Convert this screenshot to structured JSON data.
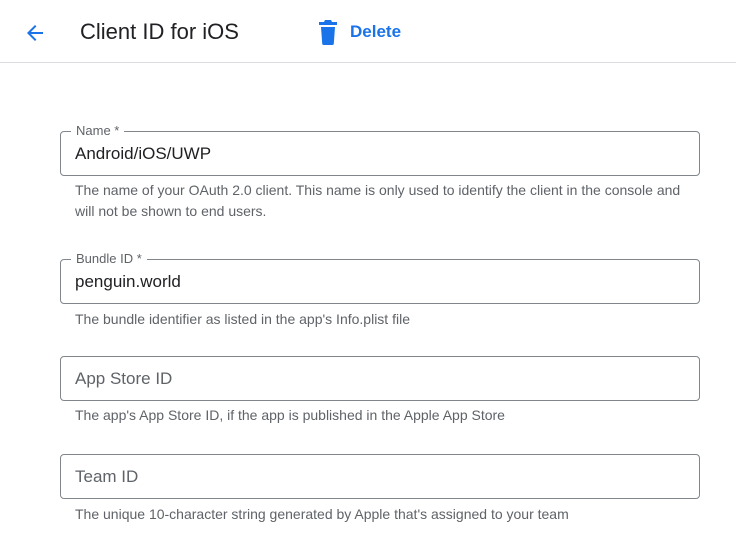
{
  "header": {
    "back_icon": "arrow-back-icon",
    "title": "Client ID for iOS",
    "delete_icon": "trash-icon",
    "delete_label": "Delete",
    "accent_color": "#1a73e8"
  },
  "form": {
    "name": {
      "label": "Name *",
      "value": "Android/iOS/UWP",
      "hint": "The name of your OAuth 2.0 client. This name is only used to identify the client in the console and will not be shown to end users."
    },
    "bundle_id": {
      "label": "Bundle ID *",
      "value": "penguin.world",
      "hint": "The bundle identifier as listed in the app's Info.plist file"
    },
    "app_store_id": {
      "placeholder": "App Store ID",
      "hint": "The app's App Store ID, if the app is published in the Apple App Store"
    },
    "team_id": {
      "placeholder": "Team ID",
      "hint": "The unique 10-character string generated by Apple that's assigned to your team"
    }
  }
}
